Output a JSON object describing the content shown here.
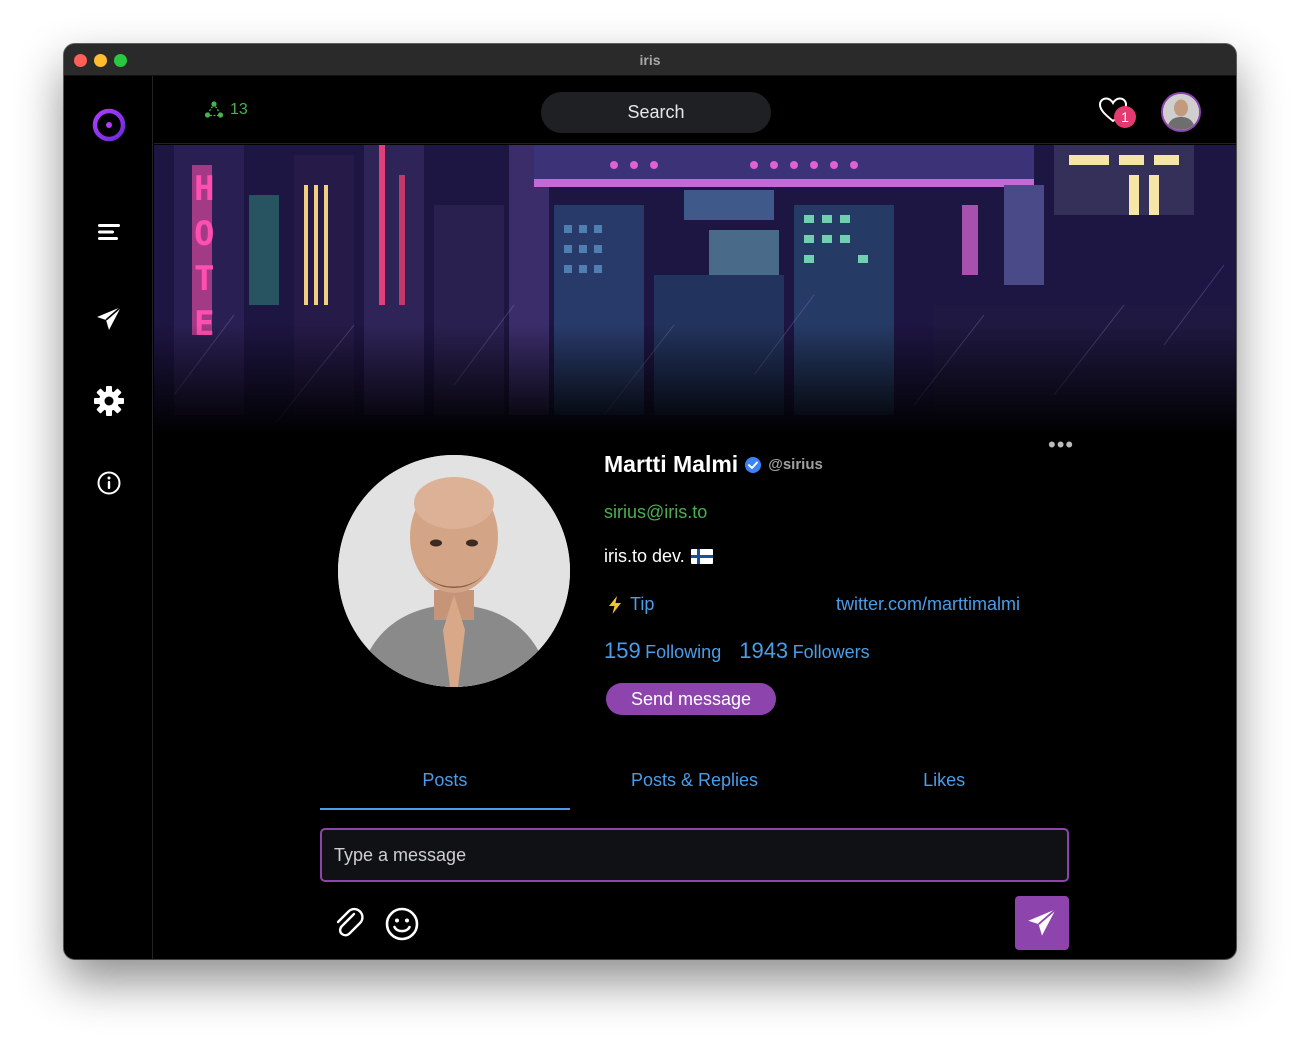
{
  "window": {
    "title": "iris"
  },
  "sidebar": {
    "items": [
      {
        "icon": "iris-logo-icon"
      },
      {
        "icon": "menu-icon"
      },
      {
        "icon": "paper-plane-icon"
      },
      {
        "icon": "gear-icon"
      },
      {
        "icon": "info-icon"
      }
    ]
  },
  "header": {
    "peer_count": "13",
    "search_label": "Search",
    "notification_count": "1"
  },
  "profile": {
    "name": "Martti Malmi",
    "handle": "@sirius",
    "nip05": "sirius@iris.to",
    "about": "iris.to dev.",
    "tip_label": "Tip",
    "website": "twitter.com/marttimalmi",
    "following_count": "159",
    "following_label": "Following",
    "followers_count": "1943",
    "followers_label": "Followers",
    "send_message_label": "Send message",
    "more_label": "•••"
  },
  "tabs": [
    {
      "label": "Posts",
      "active": true
    },
    {
      "label": "Posts & Replies",
      "active": false
    },
    {
      "label": "Likes",
      "active": false
    }
  ],
  "composer": {
    "placeholder": "Type a message"
  },
  "colors": {
    "accent": "#8e44ad",
    "link": "#4a9de8",
    "success": "#4caf50",
    "badge": "#e53a6f",
    "background": "#000000"
  }
}
